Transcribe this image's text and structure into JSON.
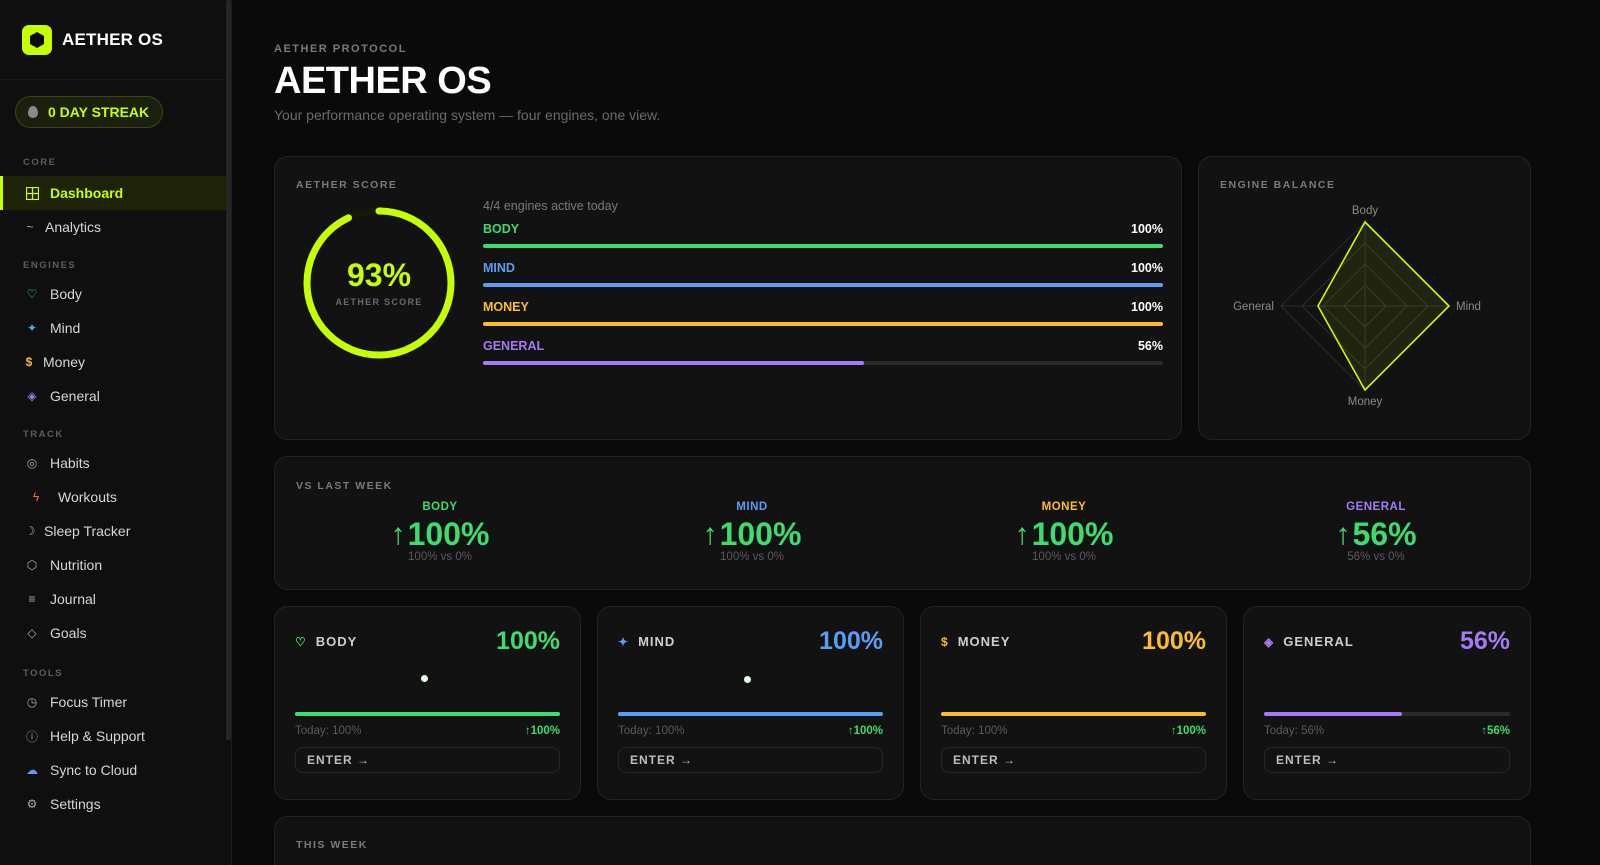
{
  "app": {
    "name": "AETHER OS"
  },
  "streak": {
    "label": "0 DAY STREAK"
  },
  "sidebar": {
    "sections": {
      "core": "CORE",
      "engines": "ENGINES",
      "track": "TRACK",
      "tools": "TOOLS"
    },
    "core": [
      {
        "label": "Dashboard",
        "icon": "grid-icon"
      },
      {
        "label": "Analytics",
        "icon": "trend-icon"
      }
    ],
    "engines": [
      {
        "label": "Body",
        "icon": "heart-icon"
      },
      {
        "label": "Mind",
        "icon": "sparkle-icon"
      },
      {
        "label": "Money",
        "icon": "dollar-icon"
      },
      {
        "label": "General",
        "icon": "diamond-icon"
      }
    ],
    "track": [
      {
        "label": "Habits",
        "icon": "target-icon"
      },
      {
        "label": "Workouts",
        "icon": "bolt-icon"
      },
      {
        "label": "Sleep Tracker",
        "icon": "moon-icon"
      },
      {
        "label": "Nutrition",
        "icon": "hexagon-icon"
      },
      {
        "label": "Journal",
        "icon": "lines-icon"
      },
      {
        "label": "Goals",
        "icon": "diamond-outline-icon"
      }
    ],
    "tools": [
      {
        "label": "Focus Timer",
        "icon": "clock-icon"
      },
      {
        "label": "Help & Support",
        "icon": "info-icon"
      },
      {
        "label": "Sync to Cloud",
        "icon": "cloud-icon"
      },
      {
        "label": "Settings",
        "icon": "gear-icon"
      }
    ]
  },
  "header": {
    "kicker": "AETHER PROTOCOL",
    "title": "AETHER OS",
    "subtitle": "Your performance operating system — four engines, one view."
  },
  "score": {
    "label": "AETHER SCORE",
    "value": "93%",
    "ring_label": "AETHER SCORE",
    "fraction": 0.93,
    "active_text": "4/4 engines active today",
    "engines": [
      {
        "name": "BODY",
        "pct": "100%",
        "fraction": 1.0,
        "color": "#3ddc6f"
      },
      {
        "name": "MIND",
        "pct": "100%",
        "fraction": 1.0,
        "color": "#5b9cf5"
      },
      {
        "name": "MONEY",
        "pct": "100%",
        "fraction": 1.0,
        "color": "#fbbf24"
      },
      {
        "name": "GENERAL",
        "pct": "56%",
        "fraction": 0.56,
        "color": "#a47bf5"
      }
    ]
  },
  "balance": {
    "label": "ENGINE BALANCE",
    "axes": [
      "Body",
      "Mind",
      "Money",
      "General"
    ],
    "values": [
      1.0,
      1.0,
      1.0,
      0.56
    ]
  },
  "compare": {
    "label": "VS LAST WEEK",
    "items": [
      {
        "name": "BODY",
        "value": "100%",
        "sub": "100% vs 0%",
        "color": "#3ddc6f"
      },
      {
        "name": "MIND",
        "value": "100%",
        "sub": "100% vs 0%",
        "color": "#5b9cf5"
      },
      {
        "name": "MONEY",
        "value": "100%",
        "sub": "100% vs 0%",
        "color": "#fbbf24"
      },
      {
        "name": "GENERAL",
        "value": "56%",
        "sub": "56% vs 0%",
        "color": "#a47bf5"
      }
    ]
  },
  "engine_cards": [
    {
      "name": "BODY",
      "icon": "heart-icon",
      "glyph": "♡",
      "pct": "100%",
      "fraction": 1.0,
      "today": "Today: 100%",
      "delta": "↑100%",
      "enter": "ENTER →",
      "color": "#3ddc6f",
      "dot": true
    },
    {
      "name": "MIND",
      "icon": "sparkle-icon",
      "glyph": "✦",
      "pct": "100%",
      "fraction": 1.0,
      "today": "Today: 100%",
      "delta": "↑100%",
      "enter": "ENTER →",
      "color": "#5b9cf5",
      "dot": true
    },
    {
      "name": "MONEY",
      "icon": "dollar-icon",
      "glyph": "$",
      "pct": "100%",
      "fraction": 1.0,
      "today": "Today: 100%",
      "delta": "↑100%",
      "enter": "ENTER →",
      "color": "#fbbf24",
      "dot": false
    },
    {
      "name": "GENERAL",
      "icon": "diamond-icon",
      "glyph": "◈",
      "pct": "56%",
      "fraction": 0.56,
      "today": "Today: 56%",
      "delta": "↑56%",
      "enter": "ENTER →",
      "color": "#a47bf5",
      "dot": false
    }
  ],
  "this_week": {
    "label": "THIS WEEK"
  },
  "colors": {
    "accent": "#c6ff00",
    "background": "#0a0a0a"
  }
}
